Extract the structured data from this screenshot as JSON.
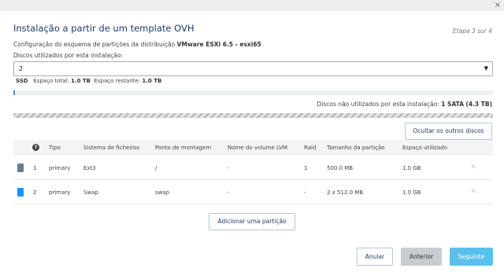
{
  "window": {
    "close_glyph": "×"
  },
  "header": {
    "title": "Instalação a partir de um template OVH",
    "step": "Etapa 3 sur 4"
  },
  "config": {
    "prefix": "Configuração do esquema de partições da distribuição ",
    "distribution": "VMware ESXi 6.5 - esxi65"
  },
  "disks": {
    "label": "Discos utilizados por esta instalação:",
    "selected": "2",
    "type": "SSD",
    "total_label": "Espaço total:",
    "total_value": "1.0 TB",
    "remaining_label": "Espaço restante:",
    "remaining_value": "1.0 TB",
    "usage_fraction": 0.003,
    "unused_label": "Discos não utilizados por esta instalação:",
    "unused_count_type": "1 SATA",
    "unused_size": "(4.3 TB)",
    "hide_button": "Ocultar os outros discos"
  },
  "table": {
    "help_glyph": "?",
    "columns": [
      "Tipo",
      "Sistema de ficheiros",
      "Ponto de montagem",
      "Nome do volume LVM",
      "Raid",
      "Tamanho da partição",
      "Espaço utilizado"
    ],
    "rows": [
      {
        "index": "1",
        "type": "primary",
        "fs": "Ext3",
        "mount": "/",
        "lvm": "-",
        "raid": "1",
        "size": "500.0 MB",
        "used": "1.0 GB",
        "color": "#6b7c8a"
      },
      {
        "index": "2",
        "type": "primary",
        "fs": "Swap",
        "mount": "swap",
        "lvm": "-",
        "raid": "-",
        "size": "2 x 512.0 MB",
        "used": "1.0 GB",
        "color": "#1e90ff"
      }
    ]
  },
  "actions": {
    "add_partition": "Adicionar uma partição",
    "cancel": "Anular",
    "previous": "Anterior",
    "next": "Seguinte"
  },
  "icons": {
    "edit": "pencil-icon",
    "help": "question-circle-icon",
    "close": "close-icon",
    "dropdown": "caret-down-icon"
  }
}
